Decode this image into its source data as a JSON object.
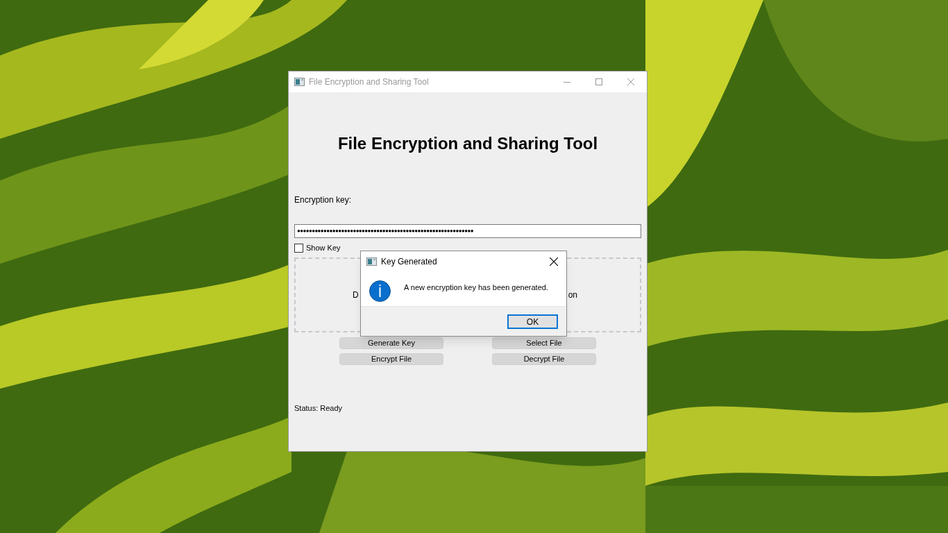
{
  "window": {
    "title": "File Encryption and Sharing Tool"
  },
  "heading": "File Encryption and Sharing Tool",
  "key_label": "Encryption key:",
  "key_field": {
    "value": "●●●●●●●●●●●●●●●●●●●●●●●●●●●●●●●●●●●●●●●●●●●●●●●●●●●●●●●●●●●●"
  },
  "show_key": {
    "label": "Show Key",
    "checked": false
  },
  "drop_zone": {
    "text_start": "D",
    "text_end": "on"
  },
  "buttons": [
    {
      "label": "Generate Key"
    },
    {
      "label": "Select File"
    },
    {
      "label": "Encrypt File"
    },
    {
      "label": "Decrypt File"
    }
  ],
  "status": "Status: Ready",
  "dialog": {
    "title": "Key Generated",
    "message": "A new encryption key has been generated.",
    "button": "OK"
  }
}
